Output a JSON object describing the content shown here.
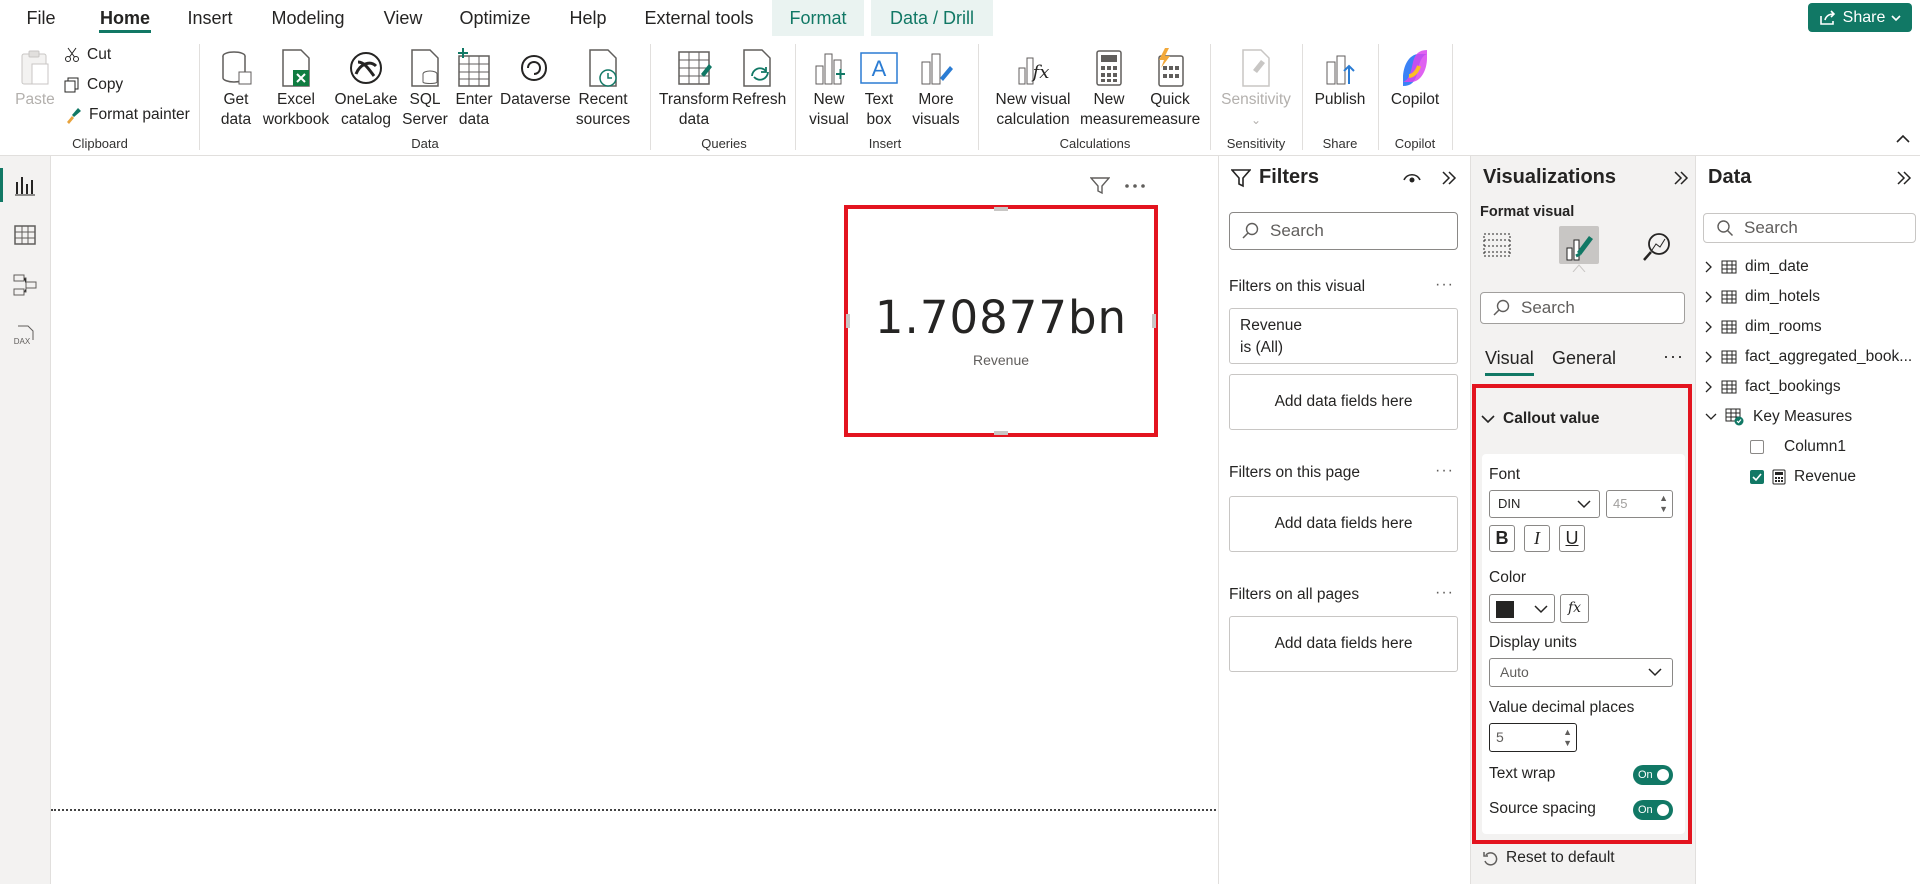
{
  "menu": {
    "tabs": [
      "File",
      "Home",
      "Insert",
      "Modeling",
      "View",
      "Optimize",
      "Help",
      "External tools",
      "Format",
      "Data / Drill"
    ],
    "share_label": "Share"
  },
  "ribbon": {
    "clipboard": {
      "paste": "Paste",
      "cut": "Cut",
      "copy": "Copy",
      "format_painter": "Format painter",
      "group": "Clipboard"
    },
    "data": {
      "get_data_1": "Get",
      "get_data_2": "data",
      "excel_1": "Excel",
      "excel_2": "workbook",
      "onelake_1": "OneLake",
      "onelake_2": "catalog",
      "sql_1": "SQL",
      "sql_2": "Server",
      "enter_1": "Enter",
      "enter_2": "data",
      "dataverse": "Dataverse",
      "recent_1": "Recent",
      "recent_2": "sources",
      "group": "Data"
    },
    "queries": {
      "transform_1": "Transform",
      "transform_2": "data",
      "refresh": "Refresh",
      "group": "Queries"
    },
    "insert": {
      "new_visual_1": "New",
      "new_visual_2": "visual",
      "text_box_1": "Text",
      "text_box_2": "box",
      "more_visuals_1": "More",
      "more_visuals_2": "visuals",
      "group": "Insert"
    },
    "calculations": {
      "new_visual_calc_1": "New visual",
      "new_visual_calc_2": "calculation",
      "new_measure_1": "New",
      "new_measure_2": "measure",
      "quick_measure_1": "Quick",
      "quick_measure_2": "measure",
      "group": "Calculations"
    },
    "sensitivity": {
      "label": "Sensitivity",
      "group": "Sensitivity"
    },
    "share": {
      "publish": "Publish",
      "group": "Share"
    },
    "copilot": {
      "label": "Copilot",
      "group": "Copilot"
    }
  },
  "card": {
    "value": "1.70877bn",
    "label": "Revenue"
  },
  "filters": {
    "title": "Filters",
    "search_placeholder": "Search",
    "on_visual": "Filters on this visual",
    "revenue_filter_name": "Revenue",
    "revenue_filter_state": "is (All)",
    "add_fields": "Add data fields here",
    "on_page": "Filters on this page",
    "on_all_pages": "Filters on all pages"
  },
  "visualizations": {
    "title": "Visualizations",
    "subtitle": "Format visual",
    "search_placeholder": "Search",
    "tab_visual": "Visual",
    "tab_general": "General",
    "section": "Callout value",
    "font_label": "Font",
    "font_family": "DIN",
    "font_size": "45",
    "bold": "B",
    "italic": "I",
    "underline": "U",
    "color_label": "Color",
    "color_value": "#252423",
    "display_units_label": "Display units",
    "display_units": "Auto",
    "decimal_label": "Value decimal places",
    "decimal_value": "5",
    "text_wrap_label": "Text wrap",
    "source_spacing_label": "Source spacing",
    "toggle_on": "On",
    "reset": "Reset to default"
  },
  "data_pane": {
    "title": "Data",
    "search_placeholder": "Search",
    "tables": [
      "dim_date",
      "dim_hotels",
      "dim_rooms",
      "fact_aggregated_book...",
      "fact_bookings"
    ],
    "key_measures": "Key Measures",
    "column1": "Column1",
    "revenue": "Revenue"
  },
  "colors": {
    "accent": "#117865",
    "highlight": "#e3141f"
  }
}
